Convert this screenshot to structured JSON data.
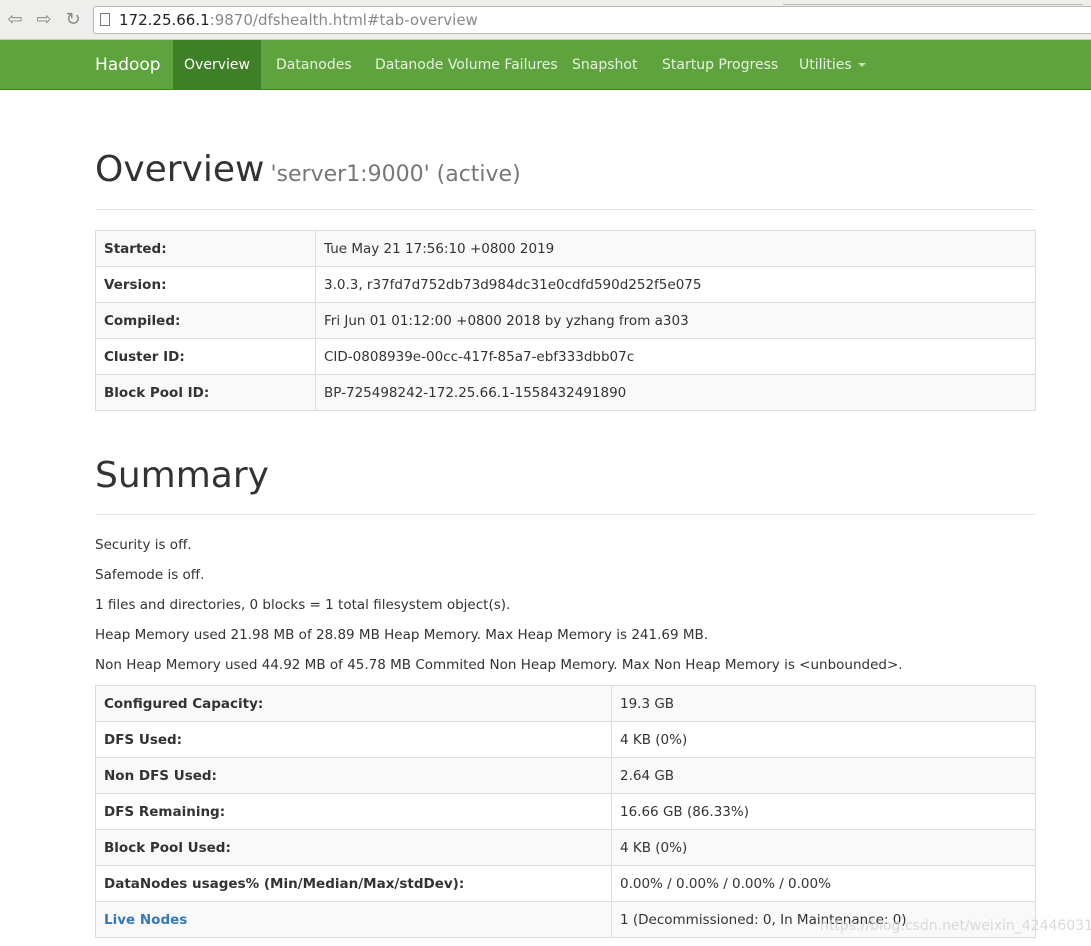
{
  "browser": {
    "url_host": "172.25.66.1",
    "url_rest": ":9870/dfshealth.html#tab-overview"
  },
  "navbar": {
    "brand": "Hadoop",
    "items": [
      {
        "label": "Overview"
      },
      {
        "label": "Datanodes"
      },
      {
        "label": "Datanode Volume Failures"
      },
      {
        "label": "Snapshot"
      },
      {
        "label": "Startup Progress"
      },
      {
        "label": "Utilities"
      }
    ]
  },
  "overview": {
    "title": "Overview",
    "subtitle": "'server1:9000' (active)",
    "rows": [
      {
        "key": "Started:",
        "value": "Tue May 21 17:56:10 +0800 2019"
      },
      {
        "key": "Version:",
        "value": "3.0.3, r37fd7d752db73d984dc31e0cdfd590d252f5e075"
      },
      {
        "key": "Compiled:",
        "value": "Fri Jun 01 01:12:00 +0800 2018 by yzhang from a303"
      },
      {
        "key": "Cluster ID:",
        "value": "CID-0808939e-00cc-417f-85a7-ebf333dbb07c"
      },
      {
        "key": "Block Pool ID:",
        "value": "BP-725498242-172.25.66.1-1558432491890"
      }
    ]
  },
  "summary": {
    "title": "Summary",
    "lines": [
      "Security is off.",
      "Safemode is off.",
      "1 files and directories, 0 blocks = 1 total filesystem object(s).",
      "Heap Memory used 21.98 MB of 28.89 MB Heap Memory. Max Heap Memory is 241.69 MB.",
      "Non Heap Memory used 44.92 MB of 45.78 MB Commited Non Heap Memory. Max Non Heap Memory is <unbounded>."
    ],
    "rows": [
      {
        "key": "Configured Capacity:",
        "value": "19.3 GB"
      },
      {
        "key": "DFS Used:",
        "value": "4 KB (0%)"
      },
      {
        "key": "Non DFS Used:",
        "value": "2.64 GB"
      },
      {
        "key": "DFS Remaining:",
        "value": "16.66 GB (86.33%)"
      },
      {
        "key": "Block Pool Used:",
        "value": "4 KB (0%)"
      },
      {
        "key": "DataNodes usages% (Min/Median/Max/stdDev):",
        "value": "0.00% / 0.00% / 0.00% / 0.00%"
      },
      {
        "key": "Live Nodes",
        "value": "1 (Decommissioned: 0, In Maintenance: 0)"
      }
    ]
  },
  "watermark": "https://blog.csdn.net/weixin_42446031"
}
